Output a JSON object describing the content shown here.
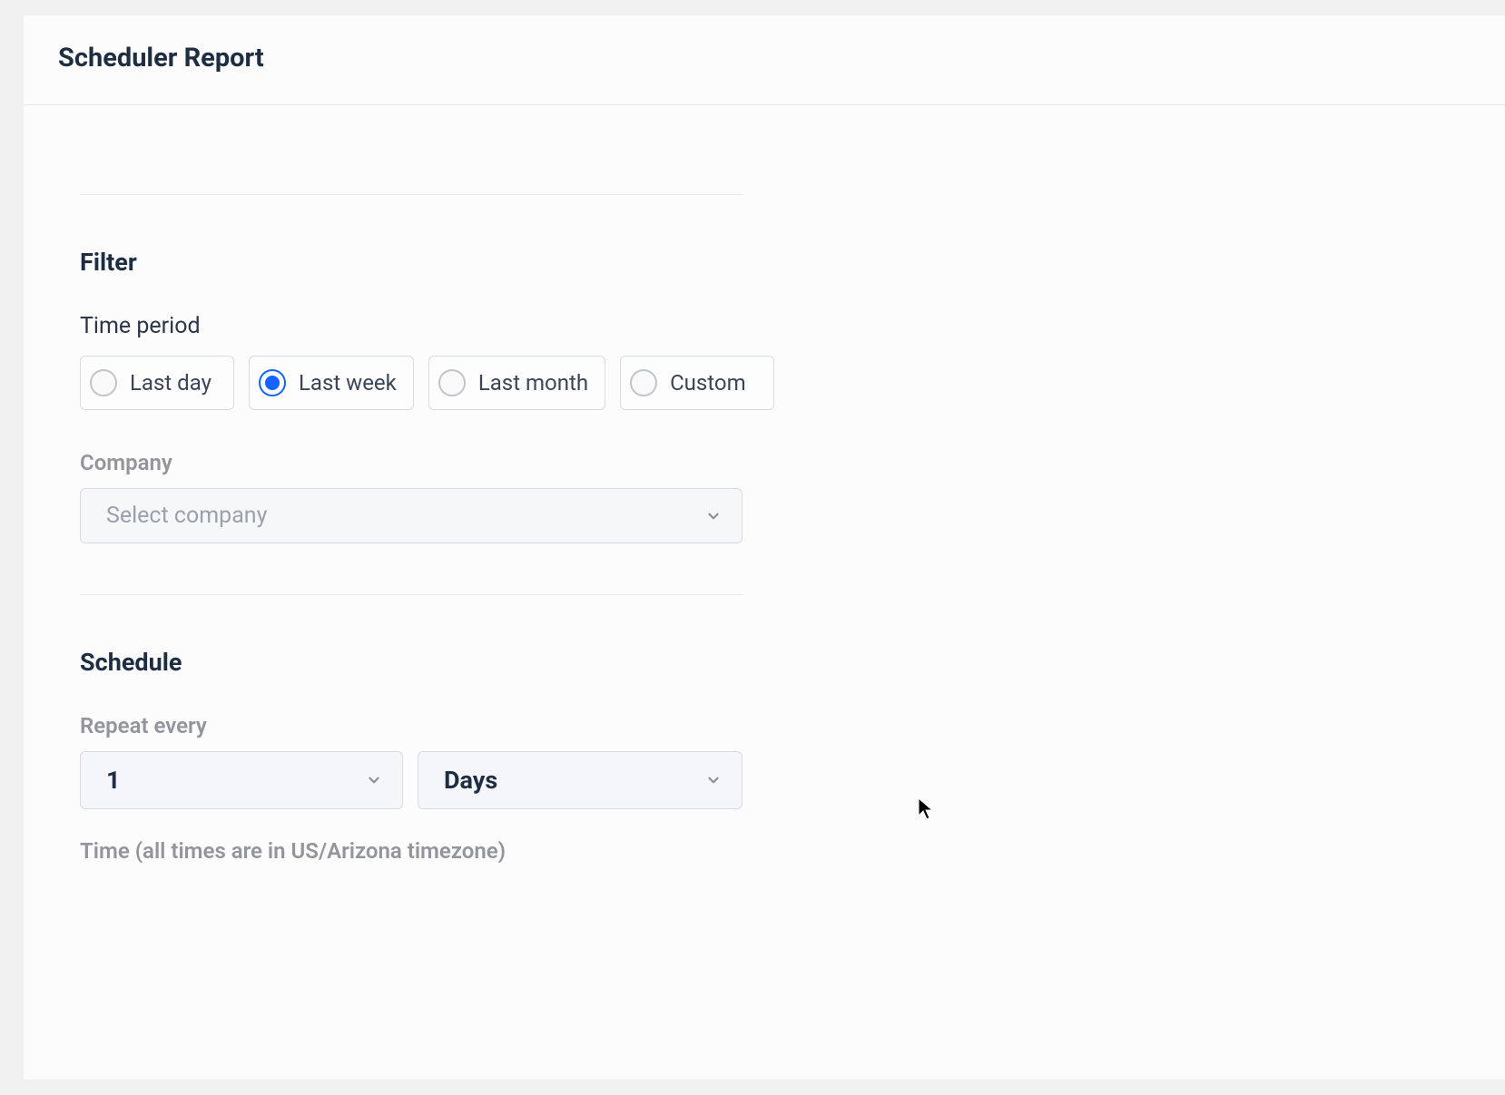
{
  "header": {
    "title": "Scheduler Report"
  },
  "filter": {
    "section_title": "Filter",
    "time_period_label": "Time period",
    "options": [
      {
        "label": "Last day",
        "selected": false
      },
      {
        "label": "Last week",
        "selected": true
      },
      {
        "label": "Last month",
        "selected": false
      },
      {
        "label": "Custom",
        "selected": false
      }
    ],
    "company_label": "Company",
    "company_placeholder": "Select company"
  },
  "schedule": {
    "section_title": "Schedule",
    "repeat_label": "Repeat every",
    "repeat_count": "1",
    "repeat_unit": "Days",
    "time_label": "Time (all times are in US/Arizona timezone)"
  }
}
